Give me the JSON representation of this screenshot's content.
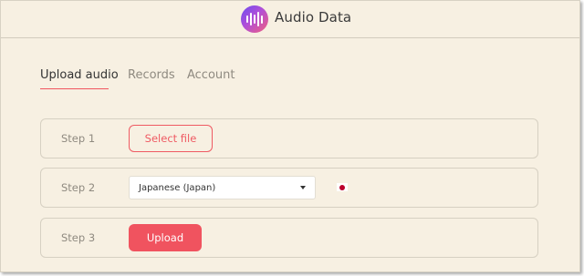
{
  "app": {
    "title": "Audio Data",
    "logo_icon": "audio-waveform-icon",
    "brand_gradient": [
      "#6a4cf0",
      "#b04fd8",
      "#f05f7e"
    ]
  },
  "tabs": [
    {
      "label": "Upload audio",
      "active": true
    },
    {
      "label": "Records",
      "active": false
    },
    {
      "label": "Account",
      "active": false
    }
  ],
  "steps": [
    {
      "label": "Step 1",
      "button_label": "Select file"
    },
    {
      "label": "Step 2",
      "language_selected": "Japanese (Japan)",
      "flag_icon": "japan-flag-icon"
    },
    {
      "label": "Step 3",
      "button_label": "Upload"
    }
  ],
  "colors": {
    "accent": "#ef5a63",
    "background": "#f7f0e2"
  }
}
